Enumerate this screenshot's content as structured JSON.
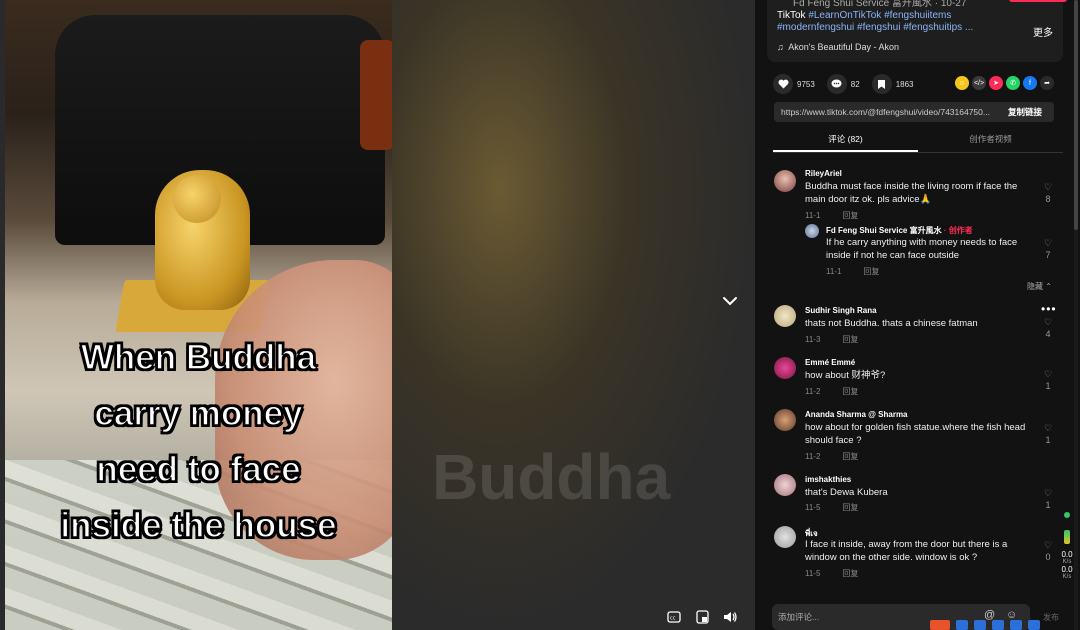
{
  "video": {
    "caption_lines": [
      "When Buddha",
      "carry money",
      "need to face",
      "inside the house"
    ],
    "blur_text": "Buddha"
  },
  "description": {
    "author_line": "Fd Feng Shui Service 富升風水 · 10-27",
    "line1_prefix": "TikTok ",
    "line1_tags": "#LearnOnTikTok #fengshuiitems",
    "line2_tags": "#modernfengshui #fengshui #fengshuitips ...",
    "more_label": "更多",
    "music": "Akon's Beautiful Day - Akon"
  },
  "stats": {
    "likes": "9753",
    "comments": "82",
    "saves": "1863"
  },
  "share_icons": [
    {
      "name": "emoji-icon",
      "color": "#f5c518"
    },
    {
      "name": "embed-icon",
      "color": "#3a3a3a"
    },
    {
      "name": "send-icon",
      "color": "#fe2c55"
    },
    {
      "name": "whatsapp-icon",
      "color": "#25d366"
    },
    {
      "name": "facebook-icon",
      "color": "#1877f2"
    },
    {
      "name": "share-arrow-icon",
      "color": "#2a2a2a"
    }
  ],
  "link": {
    "url": "https://www.tiktok.com/@fdfengshui/video/743164750...",
    "copy_label": "复制链接"
  },
  "tabs": [
    {
      "label": "评论 (82)",
      "active": true
    },
    {
      "label": "创作者视频",
      "active": false
    }
  ],
  "reply_label": "回复",
  "hide_label": "隐藏",
  "comments": [
    {
      "name": "RileyAriel",
      "text": "Buddha must face inside the living room if face the main door itz ok. pls advice🙏",
      "date": "11-1",
      "likes": "8"
    },
    {
      "name": "Fd Feng Shui Service 富升風水",
      "creator_tag": " · 创作者",
      "text": "If he carry anything with money needs to face inside if not he can face outside",
      "date": "11-1",
      "likes": "7"
    },
    {
      "name": "Sudhir Singh Rana",
      "text": "thats not Buddha. thats a chinese fatman",
      "date": "11-3",
      "likes": "4"
    },
    {
      "name": "Emmé Emmé",
      "text": "how about 财神爷?",
      "date": "11-2",
      "likes": "1"
    },
    {
      "name": "Ananda Sharma @ Sharma",
      "text": "how about for golden fish statue.where the fish head should face ?",
      "date": "11-2",
      "likes": "1"
    },
    {
      "name": "imshakthies",
      "text": "that's Dewa Kubera",
      "date": "11-5",
      "likes": "1"
    },
    {
      "name": "พี่เจ",
      "text": "I face it inside, away from the door but there is a window on the other side. window is ok ?",
      "date": "11-5",
      "likes": "0"
    }
  ],
  "comment_input": {
    "placeholder": "添加评论...",
    "send_label": "发布"
  },
  "net": {
    "up": "0.0",
    "up_unit": "K/s",
    "down": "0.0",
    "down_unit": "K/s"
  }
}
